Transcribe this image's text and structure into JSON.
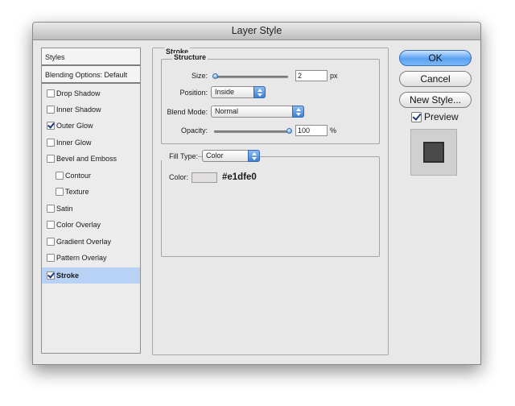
{
  "window": {
    "title": "Layer Style"
  },
  "styles_list": {
    "header": "Styles",
    "blending": "Blending Options: Default",
    "items": [
      {
        "label": "Drop Shadow",
        "checked": false
      },
      {
        "label": "Inner Shadow",
        "checked": false
      },
      {
        "label": "Outer Glow",
        "checked": true
      },
      {
        "label": "Inner Glow",
        "checked": false
      },
      {
        "label": "Bevel and Emboss",
        "checked": false
      },
      {
        "label": "Contour",
        "checked": false
      },
      {
        "label": "Texture",
        "checked": false
      },
      {
        "label": "Satin",
        "checked": false
      },
      {
        "label": "Color Overlay",
        "checked": false
      },
      {
        "label": "Gradient Overlay",
        "checked": false
      },
      {
        "label": "Pattern Overlay",
        "checked": false
      },
      {
        "label": "Stroke",
        "checked": true,
        "selected": true
      }
    ]
  },
  "stroke": {
    "title": "Stroke",
    "structure_title": "Structure",
    "size_label": "Size:",
    "size_value": "2",
    "size_unit": "px",
    "position_label": "Position:",
    "position_value": "Inside",
    "blend_label": "Blend Mode:",
    "blend_value": "Normal",
    "opacity_label": "Opacity:",
    "opacity_value": "100",
    "opacity_unit": "%",
    "fill_type_label": "Fill Type:",
    "fill_type_value": "Color",
    "color_label": "Color:",
    "color_hex": "#e1dfe0"
  },
  "buttons": {
    "ok": "OK",
    "cancel": "Cancel",
    "new_style": "New Style...",
    "preview": "Preview"
  },
  "colors": {
    "accent": "#5aa2f2",
    "selected_row": "#b7d2f4",
    "stroke_color": "#e1dfe0"
  }
}
